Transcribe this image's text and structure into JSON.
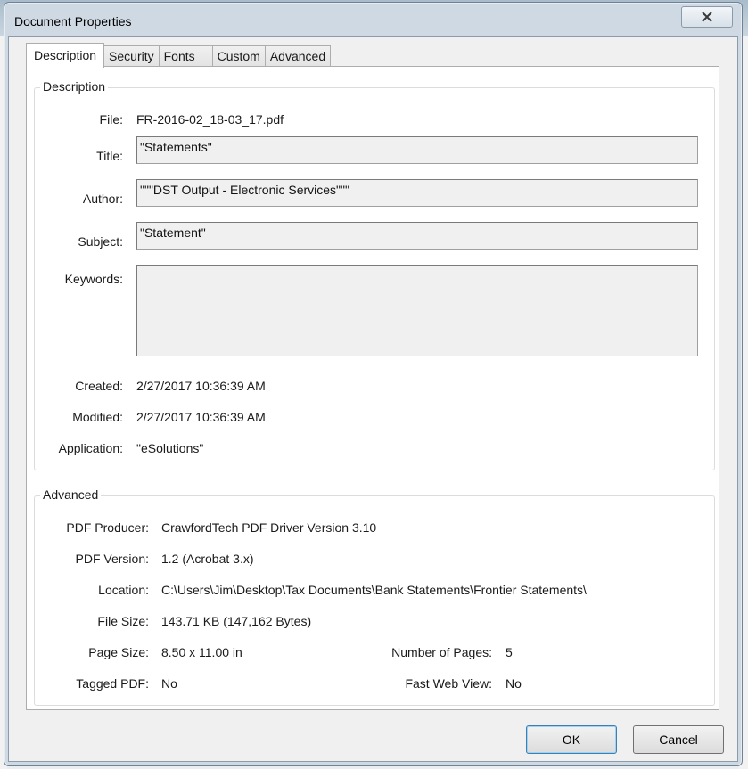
{
  "window": {
    "title": "Document Properties",
    "close_label": "✕"
  },
  "tabs": [
    {
      "label": "Description",
      "active": true
    },
    {
      "label": "Security",
      "active": false
    },
    {
      "label": "Fonts",
      "active": false
    },
    {
      "label": "Custom",
      "active": false
    },
    {
      "label": "Advanced",
      "active": false
    }
  ],
  "description": {
    "legend": "Description",
    "file_label": "File:",
    "file_value": "FR-2016-02_18-03_17.pdf",
    "title_label": "Title:",
    "title_value": "\"Statements\"",
    "author_label": "Author:",
    "author_value": "\"\"\"DST Output - Electronic Services\"\"\"",
    "subject_label": "Subject:",
    "subject_value": "\"Statement\"",
    "keywords_label": "Keywords:",
    "keywords_value": "",
    "created_label": "Created:",
    "created_value": "2/27/2017 10:36:39 AM",
    "modified_label": "Modified:",
    "modified_value": "2/27/2017 10:36:39 AM",
    "application_label": "Application:",
    "application_value": "\"eSolutions\""
  },
  "advanced": {
    "legend": "Advanced",
    "producer_label": "PDF Producer:",
    "producer_value": "CrawfordTech PDF Driver Version 3.10",
    "version_label": "PDF Version:",
    "version_value": "1.2 (Acrobat 3.x)",
    "location_label": "Location:",
    "location_value": "C:\\Users\\Jim\\Desktop\\Tax Documents\\Bank Statements\\Frontier Statements\\",
    "filesize_label": "File Size:",
    "filesize_value": "143.71 KB (147,162 Bytes)",
    "pagesize_label": "Page Size:",
    "pagesize_value": "8.50 x 11.00 in",
    "numpages_label": "Number of Pages:",
    "numpages_value": "5",
    "tagged_label": "Tagged PDF:",
    "tagged_value": "No",
    "fastweb_label": "Fast Web View:",
    "fastweb_value": "No"
  },
  "buttons": {
    "ok": "OK",
    "cancel": "Cancel"
  }
}
